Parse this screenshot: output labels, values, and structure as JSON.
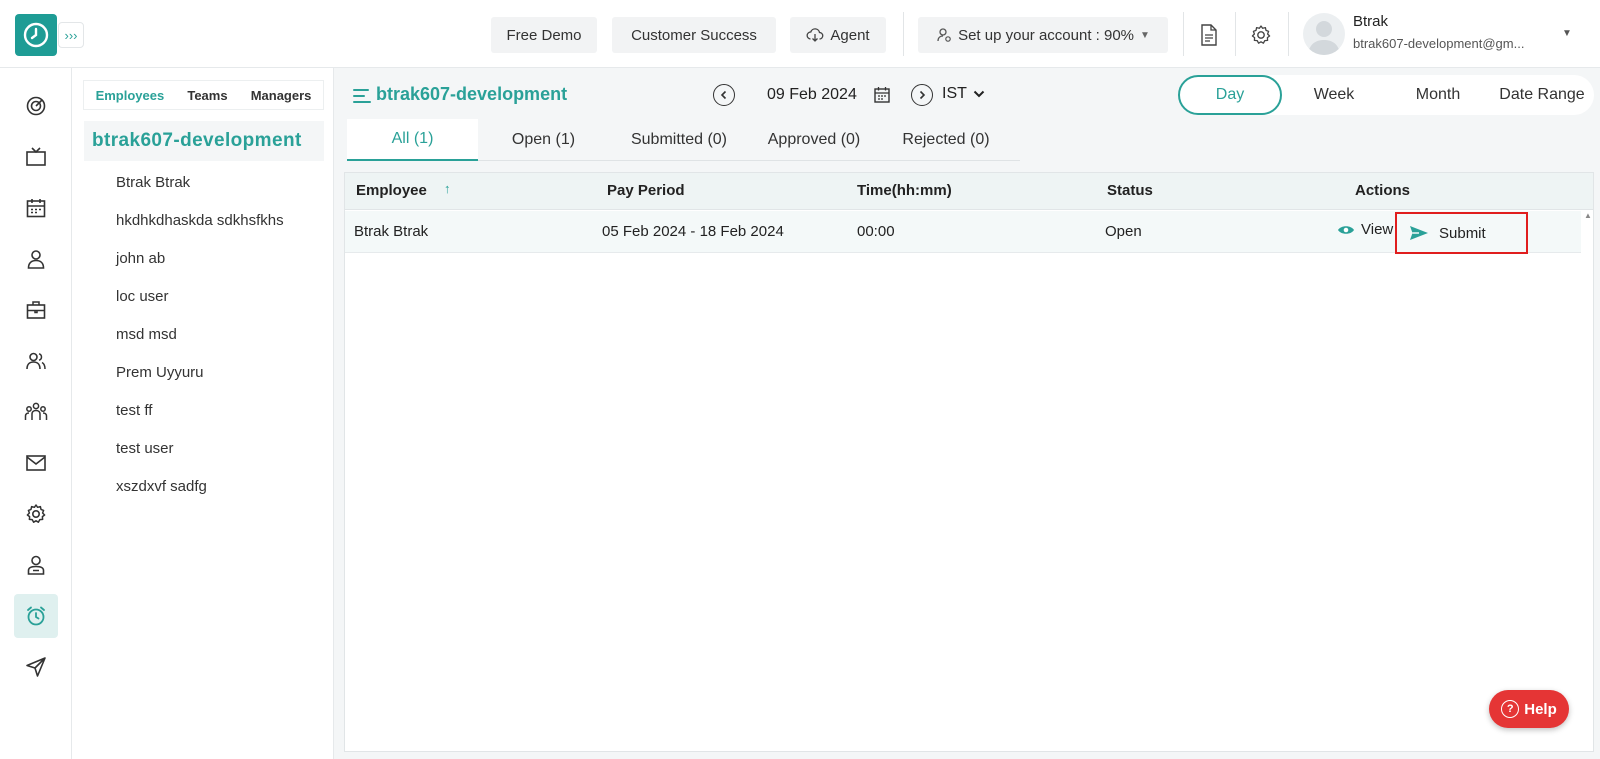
{
  "header": {
    "free_demo": "Free Demo",
    "customer_success": "Customer Success",
    "agent": "Agent",
    "setup": "Set up your account : 90%",
    "user_name": "Btrak",
    "user_email": "btrak607-development@gm..."
  },
  "panel": {
    "tabs": [
      "Employees",
      "Teams",
      "Managers"
    ],
    "org": "btrak607-development",
    "employees": [
      "Btrak Btrak",
      "hkdhkdhaskda sdkhsfkhs",
      "john ab",
      "loc user",
      "msd msd",
      "Prem Uyyuru",
      "test ff",
      "test user",
      "xszdxvf sadfg"
    ]
  },
  "main": {
    "title": "btrak607-development",
    "date": "09 Feb 2024",
    "timezone": "IST",
    "views": [
      "Day",
      "Week",
      "Month",
      "Date Range"
    ],
    "status_tabs": [
      "All (1)",
      "Open (1)",
      "Submitted (0)",
      "Approved (0)",
      "Rejected (0)"
    ]
  },
  "grid": {
    "columns": [
      "Employee",
      "Pay Period",
      "Time(hh:mm)",
      "Status",
      "Actions"
    ],
    "rows": [
      {
        "employee": "Btrak Btrak",
        "pay_period": "05 Feb 2024 - 18 Feb 2024",
        "time": "00:00",
        "status": "Open",
        "view": "View",
        "submit": "Submit"
      }
    ]
  },
  "help": "Help",
  "colors": {
    "accent": "#2aa198",
    "highlight": "#e01e1e",
    "help": "#e53535"
  }
}
